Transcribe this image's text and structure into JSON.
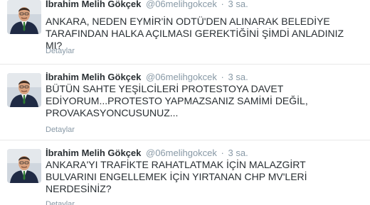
{
  "tweets": [
    {
      "fullname": "İbrahim Melih Gökçek",
      "username": "@06melihgokcek",
      "separator": "·",
      "time": "3 sa.",
      "text": "ANKARA, NEDEN EYMİR'İN ODTÜ'DEN ALINARAK BELEDİYE TARAFINDAN HALKA AÇILMASI GEREKTİĞİNİ ŞİMDİ ANLADINIZ MI?",
      "details": "Detaylar",
      "avatar": "profile-photo-icon"
    },
    {
      "fullname": "İbrahim Melih Gökçek",
      "username": "@06melihgokcek",
      "separator": "·",
      "time": "3 sa.",
      "text": "BÜTÜN SAHTE YEŞİLCİLERİ PROTESTOYA DAVET EDİYORUM...PROTESTO YAPMAZSANIZ SAMİMİ DEĞİL, PROVAKASYONCUSUNUZ...",
      "details": "Detaylar",
      "avatar": "profile-photo-icon"
    },
    {
      "fullname": "İbrahim Melih Gökçek",
      "username": "@06melihgokcek",
      "separator": "·",
      "time": "3 sa.",
      "text": "ANKARA'YI TRAFİKTE RAHATLATMAK İÇİN MALAZGİRT BULVARINI ENGELLEMEK İÇİN YIRTANAN CHP MV'LERİ NERDESİNİZ?",
      "details": "Detaylar",
      "avatar": "profile-photo-icon"
    }
  ]
}
